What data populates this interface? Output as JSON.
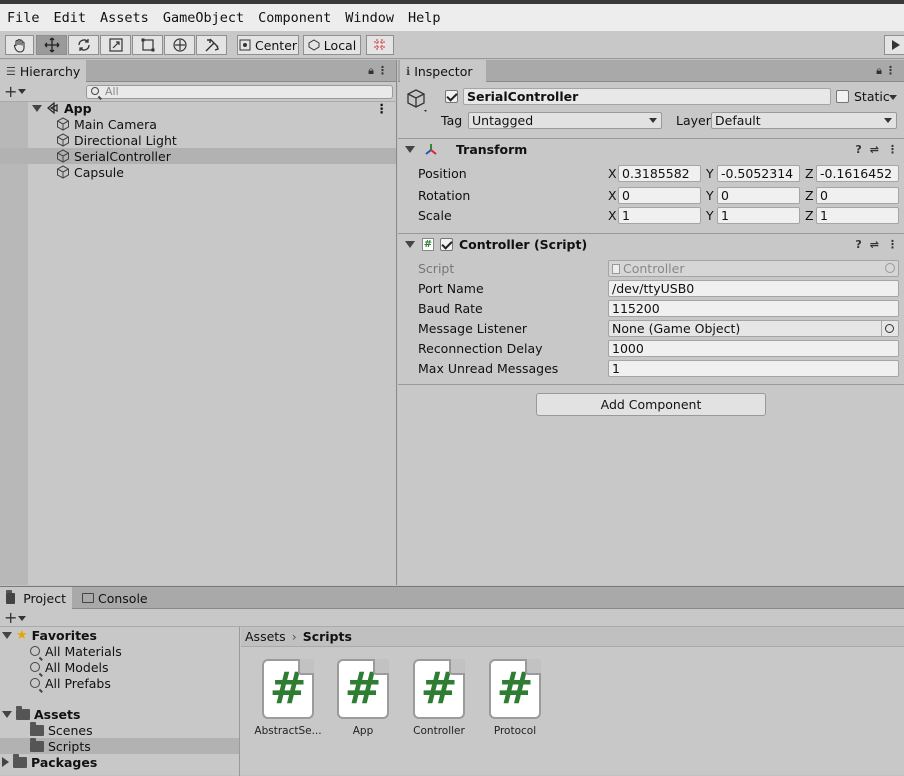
{
  "menu": [
    "File",
    "Edit",
    "Assets",
    "GameObject",
    "Component",
    "Window",
    "Help"
  ],
  "toolbar": {
    "pivot_label": "Center",
    "space_label": "Local"
  },
  "hierarchy": {
    "tab_label": "Hierarchy",
    "search_placeholder": "All",
    "scene_name": "App",
    "items": [
      "Main Camera",
      "Directional Light",
      "SerialController",
      "Capsule"
    ],
    "selected_index": 2
  },
  "inspector": {
    "tab_label": "Inspector",
    "object_name": "SerialController",
    "static_label": "Static",
    "tag_label": "Tag",
    "tag_value": "Untagged",
    "layer_label": "Layer",
    "layer_value": "Default",
    "transform": {
      "title": "Transform",
      "position_label": "Position",
      "rotation_label": "Rotation",
      "scale_label": "Scale",
      "axes": [
        "X",
        "Y",
        "Z"
      ],
      "position": [
        "0.3185582",
        "-0.5052314",
        "-0.1616452"
      ],
      "rotation": [
        "0",
        "0",
        "0"
      ],
      "scale": [
        "1",
        "1",
        "1"
      ]
    },
    "controller": {
      "title": "Controller (Script)",
      "fields": [
        {
          "label": "Script",
          "value": "Controller"
        },
        {
          "label": "Port Name",
          "value": "/dev/ttyUSB0"
        },
        {
          "label": "Baud Rate",
          "value": "115200"
        },
        {
          "label": "Message Listener",
          "value": "None (Game Object)"
        },
        {
          "label": "Reconnection Delay",
          "value": "1000"
        },
        {
          "label": "Max Unread Messages",
          "value": "1"
        }
      ]
    },
    "add_component_label": "Add Component"
  },
  "project": {
    "tab_project": "Project",
    "tab_console": "Console",
    "favorites_label": "Favorites",
    "favorites": [
      "All Materials",
      "All Models",
      "All Prefabs"
    ],
    "assets_label": "Assets",
    "asset_folders": [
      "Scenes",
      "Scripts"
    ],
    "packages_label": "Packages",
    "breadcrumb": [
      "Assets",
      "Scripts"
    ],
    "files": [
      "AbstractSe...",
      "App",
      "Controller",
      "Protocol"
    ],
    "file_glyph": "#"
  },
  "colors": {
    "selection": "#b2b2b2",
    "script_icon": "#2e7d32",
    "favorite_star": "#e0a800"
  }
}
